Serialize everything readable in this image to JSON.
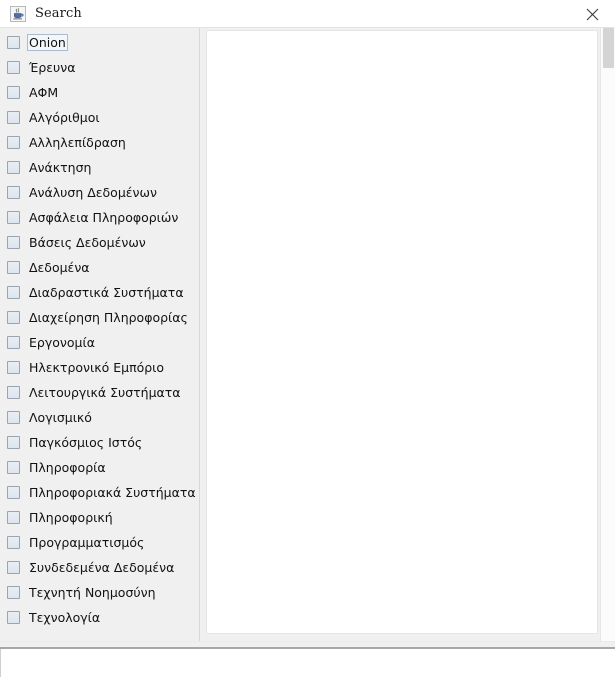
{
  "window": {
    "title": "Search",
    "icon": "java-coffee-cup-icon",
    "close_label": "✕",
    "colors": {
      "titlebar_bg": "#ffffff",
      "body_bg": "#f0f0f0",
      "panel_bg": "#ffffff",
      "text": "#121212",
      "checkbox_border": "#9aa5b1",
      "checkbox_fill": "#e3eaf2",
      "focus_border": "#a9bcd0",
      "scrollbar_thumb": "#d4d4d4"
    }
  },
  "list": {
    "name": "keyword-checkbox-list",
    "focused_index": 0,
    "items": [
      {
        "label": "Onion",
        "checked": false
      },
      {
        "label": "Έρευνα",
        "checked": false
      },
      {
        "label": "ΑΦΜ",
        "checked": false
      },
      {
        "label": "Αλγόριθμοι",
        "checked": false
      },
      {
        "label": "Αλληλεπίδραση",
        "checked": false
      },
      {
        "label": "Ανάκτηση",
        "checked": false
      },
      {
        "label": "Ανάλυση Δεδομένων",
        "checked": false
      },
      {
        "label": "Ασφάλεια Πληροφοριών",
        "checked": false
      },
      {
        "label": "Βάσεις Δεδομένων",
        "checked": false
      },
      {
        "label": "Δεδομένα",
        "checked": false
      },
      {
        "label": "Διαδραστικά Συστήματα",
        "checked": false
      },
      {
        "label": "Διαχείρηση Πληροφορίας",
        "checked": false
      },
      {
        "label": "Εργονομία",
        "checked": false
      },
      {
        "label": "Ηλεκτρονικό Εμπόριο",
        "checked": false
      },
      {
        "label": "Λειτουργικά Συστήματα",
        "checked": false
      },
      {
        "label": "Λογισμικό",
        "checked": false
      },
      {
        "label": "Παγκόσμιος Ιστός",
        "checked": false
      },
      {
        "label": "Πληροφορία",
        "checked": false
      },
      {
        "label": "Πληροφοριακά Συστήματα",
        "checked": false
      },
      {
        "label": "Πληροφορική",
        "checked": false
      },
      {
        "label": "Προγραμματισμός",
        "checked": false
      },
      {
        "label": "Συνδεδεμένα Δεδομένα",
        "checked": false
      },
      {
        "label": "Τεχνητή Νοημοσύνη",
        "checked": false
      },
      {
        "label": "Τεχνολογία",
        "checked": false
      }
    ]
  },
  "detail_pane": {
    "name": "results-panel",
    "content": ""
  }
}
